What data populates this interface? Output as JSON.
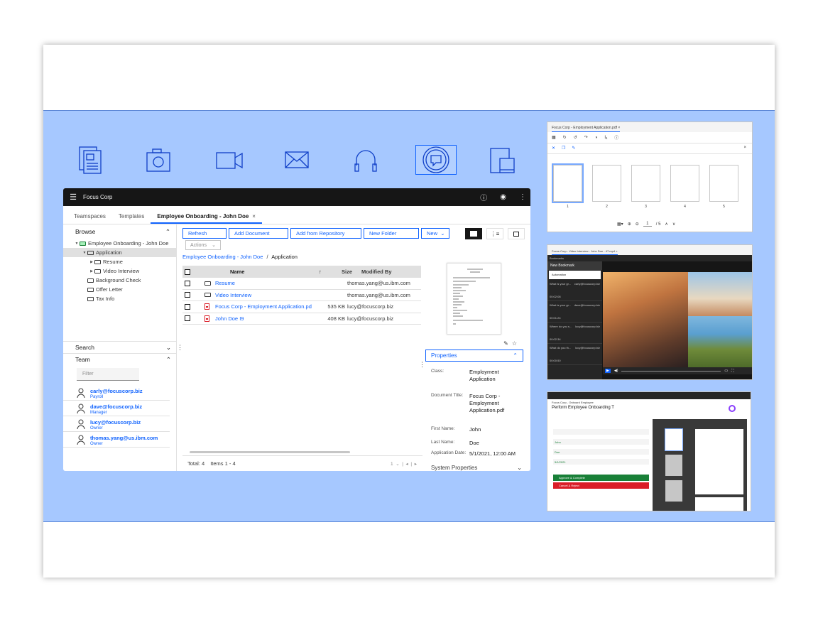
{
  "app": {
    "brand": "Focus Corp",
    "tabs": [
      {
        "label": "Teamspaces"
      },
      {
        "label": "Templates"
      },
      {
        "label": "Employee Onboarding - John Doe",
        "close": "×"
      }
    ]
  },
  "browse": {
    "title": "Browse",
    "tree": [
      {
        "label": "Employee Onboarding - John Doe"
      },
      {
        "label": "Application"
      },
      {
        "label": "Resume"
      },
      {
        "label": "Video Interview"
      },
      {
        "label": "Background Check"
      },
      {
        "label": "Offer Letter"
      },
      {
        "label": "Tax Info"
      }
    ]
  },
  "search": {
    "title": "Search"
  },
  "team": {
    "title": "Team",
    "filter_placeholder": "Filter",
    "members": [
      {
        "email": "carly@focuscorp.biz",
        "role": "Payroll"
      },
      {
        "email": "dave@focuscorp.biz",
        "role": "Manager"
      },
      {
        "email": "lucy@focuscorp.biz",
        "role": "Owner"
      },
      {
        "email": "thomas.yang@us.ibm.com",
        "role": "Owner"
      }
    ]
  },
  "toolbar": {
    "refresh": "Refresh",
    "add_document": "Add Document",
    "add_from_repository": "Add from Repository",
    "new_folder": "New Folder",
    "new": "New",
    "actions": "Actions"
  },
  "breadcrumb": {
    "root": "Employee Onboarding - John Doe",
    "sep": "/",
    "current": "Application"
  },
  "grid": {
    "headers": {
      "name": "Name",
      "size": "Size",
      "modified_by": "Modified By"
    },
    "rows": [
      {
        "name": "Resume",
        "size": "",
        "modified_by": "thomas.yang@us.ibm.com",
        "type": "folder"
      },
      {
        "name": "Video Interview",
        "size": "",
        "modified_by": "thomas.yang@us.ibm.com",
        "type": "folder"
      },
      {
        "name": "Focus Corp - Employment Application.pdf",
        "size": "535 KB",
        "modified_by": "lucy@focuscorp.biz",
        "type": "pdf"
      },
      {
        "name": "John Doe I9",
        "size": "408 KB",
        "modified_by": "lucy@focuscorp.biz",
        "type": "pdf"
      }
    ],
    "total": "Total: 4",
    "items": "Items 1 - 4",
    "page": "1"
  },
  "properties": {
    "title": "Properties",
    "fields": [
      {
        "key": "Class:",
        "value": "Employment Application"
      },
      {
        "key": "Document Title:",
        "value": "Focus Corp - Employment Application.pdf"
      },
      {
        "key": "First Name:",
        "value": "John"
      },
      {
        "key": "Last Name:",
        "value": "Doe"
      },
      {
        "key": "Application Date:",
        "value": "5/1/2021, 12:00 AM"
      }
    ],
    "system": "System Properties"
  },
  "pdf_viewer": {
    "tab": "Focus Corp - Employment Application.pdf",
    "pages": [
      "1",
      "2",
      "3",
      "4",
      "5"
    ],
    "page_input": "1",
    "page_total": "/ 5"
  },
  "video_viewer": {
    "tab": "Focus Corp - Video Interview - John Doe - 47.mp4",
    "panel": "Bookmarks",
    "new_bookmark": "New Bookmark",
    "filter": "Automation",
    "bookmarks": [
      {
        "text": "What is your gr...",
        "user": "carly@focuscorp.biz",
        "time": "00:02:08"
      },
      {
        "text": "What is your gr...",
        "user": "dave@focuscorp.biz",
        "time": "00:01:24"
      },
      {
        "text": "Where do you s...",
        "user": "lucy@focuscorp.biz",
        "time": "00:02:34"
      },
      {
        "text": "What do you th...",
        "user": "lucy@focuscorp.biz",
        "time": "00:00:50"
      }
    ]
  },
  "task_window": {
    "header": "Focus Corp - Onboard Employee",
    "title": "Perform Employee Onboarding T",
    "fields": [
      "John",
      "Doe",
      "5/1/2021"
    ],
    "approve": "Approve & Complete",
    "reject": "Cancel & Reject"
  },
  "colors": {
    "accent": "#0f62fe",
    "band": "#a6c8ff",
    "dark": "#161616"
  }
}
